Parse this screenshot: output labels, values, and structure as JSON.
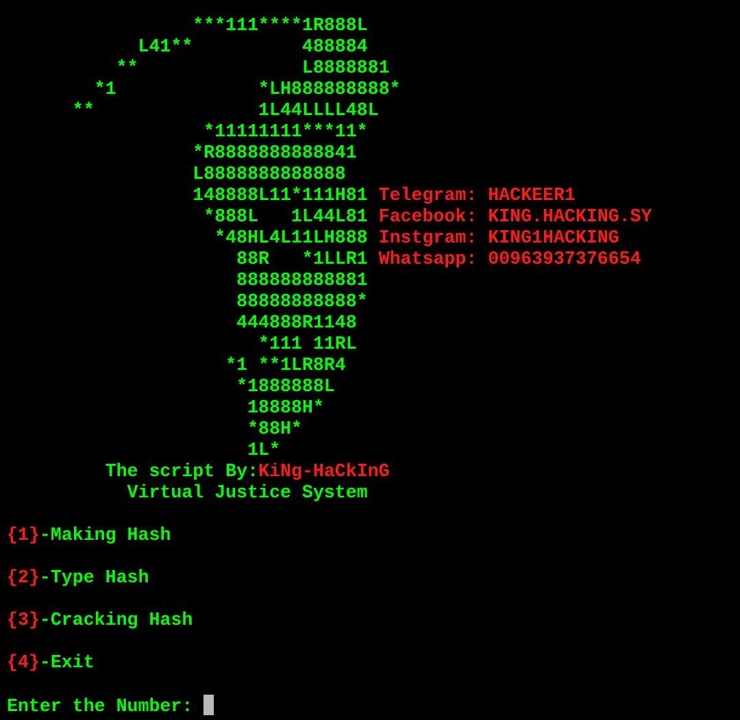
{
  "colors": {
    "background": "#000000",
    "primary_text": "#00ff00",
    "accent_text": "#ff1a1a",
    "cursor": "#b8b8b8"
  },
  "banner": {
    "art_lines": [
      "                 ***111****1R888L",
      "            L41**          488884",
      "          **               L8888881",
      "        *1             *LH888888888*",
      "      **               1L44LLLL48L",
      "                  *11111111***11*",
      "                 *R8888888888841",
      "                 L8888888888888",
      "                 148888L11*111H81",
      "                  *888L   1L44L81",
      "                   *48HL4L11LH888",
      "                     88R   *1LLR1",
      "                     888888888881",
      "                     88888888888*",
      "                     444888R1148",
      "                       *111 11RL",
      "                    *1 **1LR8R4",
      "                     *1888888L",
      "                      18888H*",
      "                      *88H*",
      "                      1L*"
    ],
    "contacts": [
      "Telegram: HACKEER1",
      "Facebook: KING.HACKING.SY",
      "Instgram: KING1HACKING",
      "Whatsapp: 00963937376654"
    ],
    "credit_prefix": "         The script By:",
    "credit_author": "KiNg-HaCkInG",
    "subtitle": "           Virtual Justice System"
  },
  "menu": {
    "items": [
      {
        "key": "{1}",
        "label": "-Making Hash"
      },
      {
        "key": "{2}",
        "label": "-Type Hash"
      },
      {
        "key": "{3}",
        "label": "-Cracking Hash"
      },
      {
        "key": "{4}",
        "label": "-Exit"
      }
    ]
  },
  "prompt": {
    "text": "Enter the Number: "
  }
}
